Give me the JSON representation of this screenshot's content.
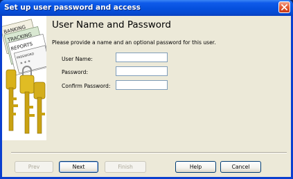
{
  "window": {
    "title": "Set up user password and access"
  },
  "banner": {
    "words": [
      "BANKING",
      "TRACKING",
      "REPORTS",
      "PASSWORD"
    ]
  },
  "page": {
    "heading": "User Name and Password",
    "description": "Please provide a name and an optional password for this user."
  },
  "fields": [
    {
      "label": "User Name:",
      "value": ""
    },
    {
      "label": "Password:",
      "value": ""
    },
    {
      "label": "Confirm Password:",
      "value": ""
    }
  ],
  "buttons": {
    "prev": "Prev",
    "next": "Next",
    "finish": "Finish",
    "help": "Help",
    "cancel": "Cancel"
  },
  "colors": {
    "titlebar": "#0550dd",
    "dialog_bg": "#ece9d8",
    "close": "#e5582f"
  }
}
